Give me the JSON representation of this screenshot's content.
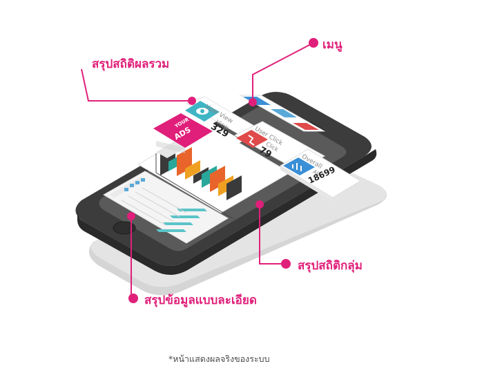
{
  "callouts": {
    "menu": "เมนู",
    "overall_summary": "สรุปสถิติผลรวม",
    "group_summary": "สรุปสถิติกลุ่ม",
    "detail_summary": "สรุปข้อมูลแบบละเอียด"
  },
  "cards": {
    "user_view": {
      "title": "User View",
      "sub": "View",
      "value": "329"
    },
    "user_click": {
      "title": "User Click",
      "sub": "Click",
      "value": "79"
    },
    "overall": {
      "title": "Overall",
      "sub": "All",
      "value": "18699"
    }
  },
  "logo": {
    "line1": "YOUR",
    "line2": "ADS"
  },
  "footnote": "*หน้าแสดงผลจริงของระบบ",
  "colors": {
    "accent": "#e01f7a",
    "teal": "#2aa79b",
    "orange": "#e8642a",
    "dark": "#3a3a3a",
    "blue": "#3b8fd6",
    "red": "#e04a4a"
  },
  "chart_data": {
    "type": "bar",
    "series_colors": [
      "#3a3a3a",
      "#2aa79b",
      "#e8642a",
      "#f0a020"
    ]
  }
}
